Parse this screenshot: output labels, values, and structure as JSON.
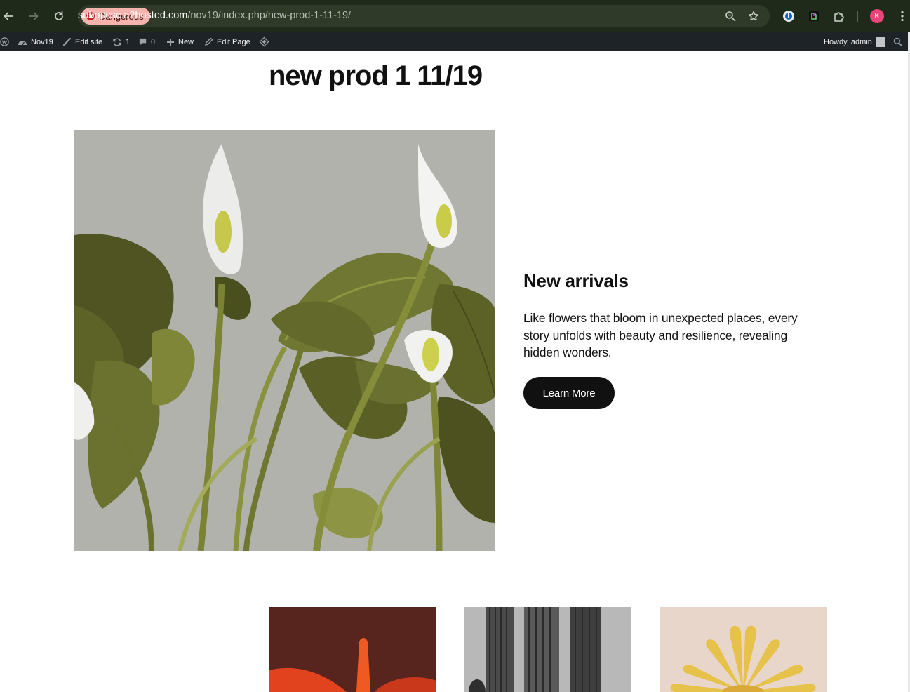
{
  "browser": {
    "security_label": "Dangerous",
    "url_host": "subppcsc.a2hosted.com",
    "url_path": "/nov19/index.php/new-prod-1-11-19/",
    "profile_initial": "K"
  },
  "admin_bar": {
    "site_name": "Nov19",
    "edit_site": "Edit site",
    "updates_count": "1",
    "comments_count": "0",
    "new_label": "New",
    "edit_page": "Edit Page",
    "greeting": "Howdy, admin"
  },
  "page": {
    "title": "new prod 1 11/19",
    "hero": {
      "heading": "New arrivals",
      "body": "Like flowers that bloom in unexpected places, every story unfolds with beauty and resilience, revealing hidden wonders.",
      "button_label": "Learn More"
    }
  },
  "colors": {
    "browser_bg": "#1f2a1a",
    "admin_bar_bg": "#1d2327",
    "danger_chip": "#f6b2ad",
    "button_bg": "#111111",
    "profile_avatar": "#e8457a"
  }
}
